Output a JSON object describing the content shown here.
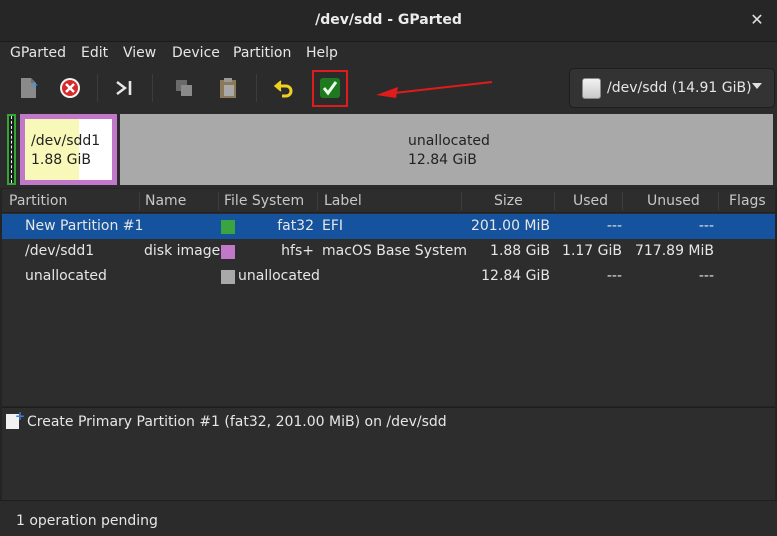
{
  "window": {
    "title": "/dev/sdd - GParted"
  },
  "menu": [
    "GParted",
    "Edit",
    "View",
    "Device",
    "Partition",
    "Help"
  ],
  "toolbar": {
    "buttons": [
      "new-icon",
      "delete-icon",
      "resize-move-icon",
      "copy-icon",
      "paste-icon",
      "undo-icon",
      "apply-icon"
    ],
    "highlighted": "apply-icon",
    "highlight_color": "#e01b1b"
  },
  "device": {
    "label": "/dev/sdd (14.91 GiB)"
  },
  "diskmap": {
    "sdd1": {
      "name": "/dev/sdd1",
      "size": "1.88 GiB",
      "used_fraction": 0.62,
      "color": "#c178c9"
    },
    "unallocated": {
      "name": "unallocated",
      "size": "12.84 GiB",
      "color": "#a9a9a9"
    }
  },
  "table": {
    "headers": [
      "Partition",
      "Name",
      "File System",
      "Label",
      "Size",
      "Used",
      "Unused",
      "Flags"
    ],
    "rows": [
      {
        "partition": "New Partition #1",
        "name": "",
        "fs": "fat32",
        "fs_color": "#3aa540",
        "label": "EFI",
        "size": "201.00 MiB",
        "used": "---",
        "unused": "---",
        "flags": ""
      },
      {
        "partition": "/dev/sdd1",
        "name": "disk image",
        "fs": "hfs+",
        "fs_color": "#c178c9",
        "label": "macOS Base System",
        "size": "1.88 GiB",
        "used": "1.17 GiB",
        "unused": "717.89 MiB",
        "flags": ""
      },
      {
        "partition": "unallocated",
        "name": "",
        "fs": "unallocated",
        "fs_color": "#a9a9a9",
        "label": "",
        "size": "12.84 GiB",
        "used": "---",
        "unused": "---",
        "flags": ""
      }
    ],
    "selected_row": 0
  },
  "operations": [
    "Create Primary Partition #1 (fat32, 201.00 MiB) on /dev/sdd"
  ],
  "status": "1 operation pending"
}
